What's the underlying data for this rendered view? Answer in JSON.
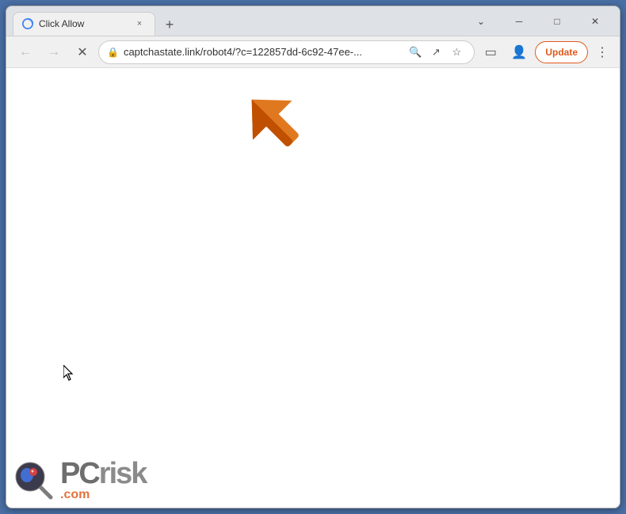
{
  "window": {
    "title": "Click Allow",
    "controls": {
      "minimize": "─",
      "maximize": "□",
      "close": "✕",
      "chevron_down": "⌄"
    }
  },
  "tab": {
    "title": "Click Allow",
    "close": "×"
  },
  "new_tab": "+",
  "toolbar": {
    "back": "←",
    "forward": "→",
    "reload": "✕",
    "address": "captchastate.link/robot4/?c=122857dd-6c92-47ee-...",
    "search_icon": "🔍",
    "share_icon": "↗",
    "bookmark_icon": "☆",
    "sidebar_icon": "▭",
    "profile_icon": "👤",
    "update_label": "Update",
    "menu_icon": "⋮",
    "lock_icon": "🔒"
  },
  "watermark": {
    "pc": "PC",
    "risk": "risk",
    "domain": ".com"
  },
  "arrow": {
    "color": "#e07820",
    "shadow_color": "#c05000"
  }
}
